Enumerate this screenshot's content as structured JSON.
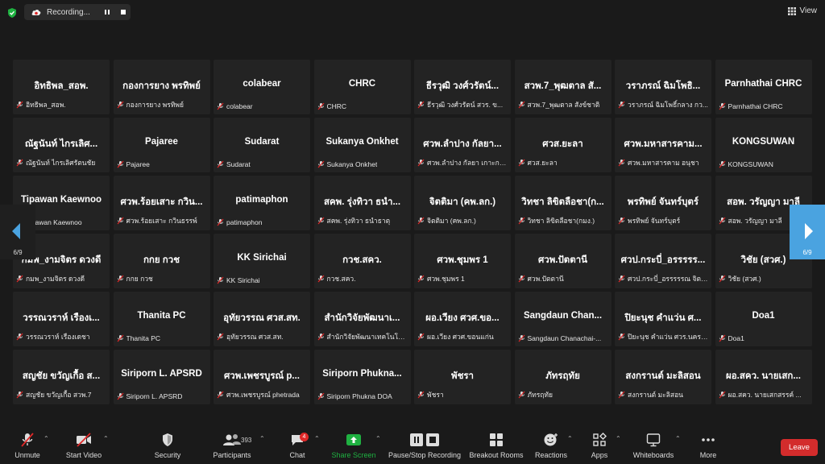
{
  "top": {
    "recording_label": "Recording...",
    "view_label": "View"
  },
  "participants": [
    {
      "big": "อิทธิพล_สอพ.",
      "small": "อิทธิพล_สอพ."
    },
    {
      "big": "กองการยาง พรทิพย์",
      "small": "กองการยาง พรทิพย์"
    },
    {
      "big": "colabear",
      "small": "colabear"
    },
    {
      "big": "CHRC",
      "small": "CHRC"
    },
    {
      "big": "ธีรวุฒิ วงศ์วรัตน์...",
      "small": "ธีรวุฒิ วงศ์วรัตน์ สวร. ข..."
    },
    {
      "big": "สวพ.7_พุฒตาล สั...",
      "small": "สวพ.7_พุฒตาล สังข์ชาติ"
    },
    {
      "big": "วราภรณ์ ฉิมโพธิ...",
      "small": "วราภรณ์ ฉิมโพธิ์กลาง กว..."
    },
    {
      "big": "Parnhathai CHRC",
      "small": "Parnhathai CHRC"
    },
    {
      "big": "ณัฐนันท์ ไกรเลิศ...",
      "small": "ณัฐนันท์ ไกรเลิศรัตนชัย"
    },
    {
      "big": "Pajaree",
      "small": "Pajaree"
    },
    {
      "big": "Sudarat",
      "small": "Sudarat"
    },
    {
      "big": "Sukanya Onkhet",
      "small": "Sukanya Onkhet"
    },
    {
      "big": "ศวพ.ลำปาง กัลยา...",
      "small": "ศวพ.ลำปาง กัลยา เกาะกา..."
    },
    {
      "big": "ศวส.ยะลา",
      "small": "ศวส.ยะลา"
    },
    {
      "big": "ศวพ.มหาสารคาม...",
      "small": "ศวพ.มหาสารคาม อนุชา"
    },
    {
      "big": "KONGSUWAN",
      "small": "KONGSUWAN"
    },
    {
      "big": "Tipawan Kaewnoo",
      "small": "Tipawan Kaewnoo"
    },
    {
      "big": "ศวพ.ร้อยเสาะ กวิน...",
      "small": "ศวพ.ร้อยเสาะ กวินธรรพ์"
    },
    {
      "big": "patimaphon",
      "small": "patimaphon"
    },
    {
      "big": "สคพ. รุ่งทิวา ธนำ...",
      "small": "สคพ. รุ่งทิวา ธนำธาตุ"
    },
    {
      "big": "จิตติมา (คพ.ลก.)",
      "small": "จิตติมา (คพ.ลก.)"
    },
    {
      "big": "วิทชา ลิขิตลือชา(ก...",
      "small": "วิทชา ลิขิตลือชา(กมง.)"
    },
    {
      "big": "พรทิพย์ จันทร์บุตร์",
      "small": "พรทิพย์ จันทร์บุตร์"
    },
    {
      "big": "สอพ. วรัญญา มาลี",
      "small": "สอพ. วรัญญา มาลี"
    },
    {
      "big": "กมพ_งามจิตร ดวงดี",
      "small": "กมพ_งามจิตร ดวงดี"
    },
    {
      "big": "กกย กวช",
      "small": "กกย กวช"
    },
    {
      "big": "KK Sirichai",
      "small": "KK Sirichai"
    },
    {
      "big": "กวช.สคว.",
      "small": "กวช.สคว."
    },
    {
      "big": "ศวพ.ชุมพร 1",
      "small": "ศวพ.ชุมพร 1"
    },
    {
      "big": "ศวพ.ปัตตานี",
      "small": "ศวพ.ปัตตานี"
    },
    {
      "big": "ศวป.กระบี่_อรรรรร...",
      "small": "ศวป.กระบี่_อรรรรรณ จิตต์..."
    },
    {
      "big": "วิชัย (สวศ.)",
      "small": "วิชัย (สวศ.)"
    },
    {
      "big": "วรรณวราห์ เรืองเ...",
      "small": "วรรณวราห์ เรืองเดชา"
    },
    {
      "big": "Thanita PC",
      "small": "Thanita PC"
    },
    {
      "big": "อุทัยวรรณ ศวส.สท.",
      "small": "อุทัยวรรณ ศวส.สท."
    },
    {
      "big": "สำนักวิจัยพัฒนาเ...",
      "small": "สำนักวิจัยพัฒนาเทคโนโล..."
    },
    {
      "big": "ผอ.เวียง ศวศ.ขอ...",
      "small": "ผอ.เวียง ศวศ.ขอนแก่น"
    },
    {
      "big": "Sangdaun Chan...",
      "small": "Sangdaun Chanachai-..."
    },
    {
      "big": "ปิยะนุช คำแว่น ศ...",
      "small": "ปิยะนุช คำแว่น ศวร.นครส..."
    },
    {
      "big": "Doa1",
      "small": "Doa1"
    },
    {
      "big": "สญชัย ขวัญเกื้อ ส...",
      "small": "สญชัย ขวัญเกื้อ สวพ.7"
    },
    {
      "big": "Siriporn L. APSRD",
      "small": "Siriporn L. APSRD"
    },
    {
      "big": "ศวพ.เพชรบูรณ์ p...",
      "small": "ศวพ.เพชรบูรณ์ phetrada"
    },
    {
      "big": "Siriporn Phukna...",
      "small": "Siriporn Phukna DOA"
    },
    {
      "big": "พัชรา",
      "small": "พัชรา"
    },
    {
      "big": "ภัทรฤทัย",
      "small": "ภัทรฤทัย"
    },
    {
      "big": "สงกรานต์ มะลิสอน",
      "small": "สงกรานต์ มะลิสอน"
    },
    {
      "big": "ผอ.สคว. นายเสก...",
      "small": "ผอ.สคว. นายเสกสรรค์ ..."
    }
  ],
  "nav": {
    "left_page": "6/9",
    "right_page": "6/9"
  },
  "toolbar": {
    "unmute": "Unmute",
    "start_video": "Start Video",
    "security": "Security",
    "participants": "Participants",
    "participants_count": "393",
    "chat": "Chat",
    "chat_badge": "4",
    "share_screen": "Share Screen",
    "pause_stop": "Pause/Stop Recording",
    "breakout": "Breakout Rooms",
    "reactions": "Reactions",
    "apps": "Apps",
    "whiteboards": "Whiteboards",
    "more": "More",
    "leave": "Leave"
  },
  "colors": {
    "accent_blue": "#4aa3e0",
    "leave_red": "#d32c2c",
    "share_green": "#1fb141",
    "mute_red": "#e02828"
  }
}
